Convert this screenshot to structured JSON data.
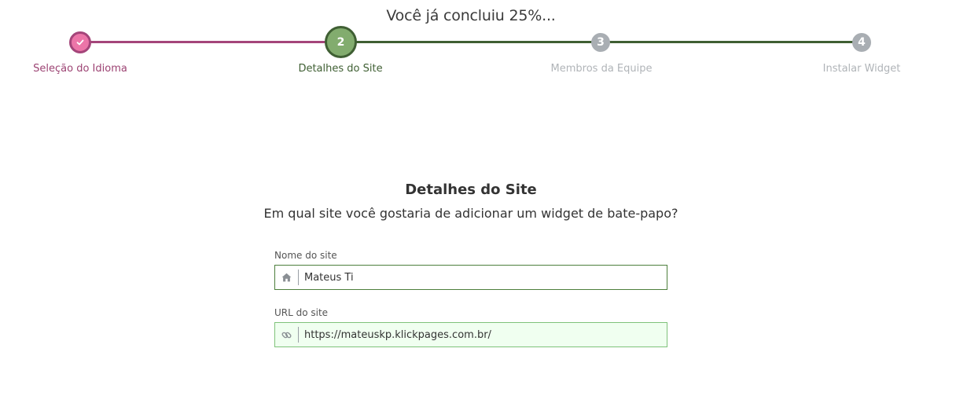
{
  "progress": {
    "text": "Você já concluiu 25%...",
    "percent": 25
  },
  "steps": [
    {
      "number": "",
      "label": "Seleção do Idioma",
      "state": "done",
      "icon": "check-icon",
      "color": "#a4457a"
    },
    {
      "number": "2",
      "label": "Detalhes do Site",
      "state": "current",
      "color": "#3f5f33"
    },
    {
      "number": "3",
      "label": "Membros da Equipe",
      "state": "todo",
      "color": "#a9aeb3"
    },
    {
      "number": "4",
      "label": "Instalar Widget",
      "state": "todo",
      "color": "#a9aeb3"
    }
  ],
  "form": {
    "title": "Detalhes do Site",
    "subtitle": "Em qual site você gostaria de adicionar um widget de bate-papo?",
    "site_name": {
      "label": "Nome do site",
      "value": "Mateus Ti",
      "icon": "home-icon"
    },
    "site_url": {
      "label": "URL do site",
      "value": "https://mateuskp.klickpages.com.br/",
      "icon": "link-icon"
    }
  }
}
